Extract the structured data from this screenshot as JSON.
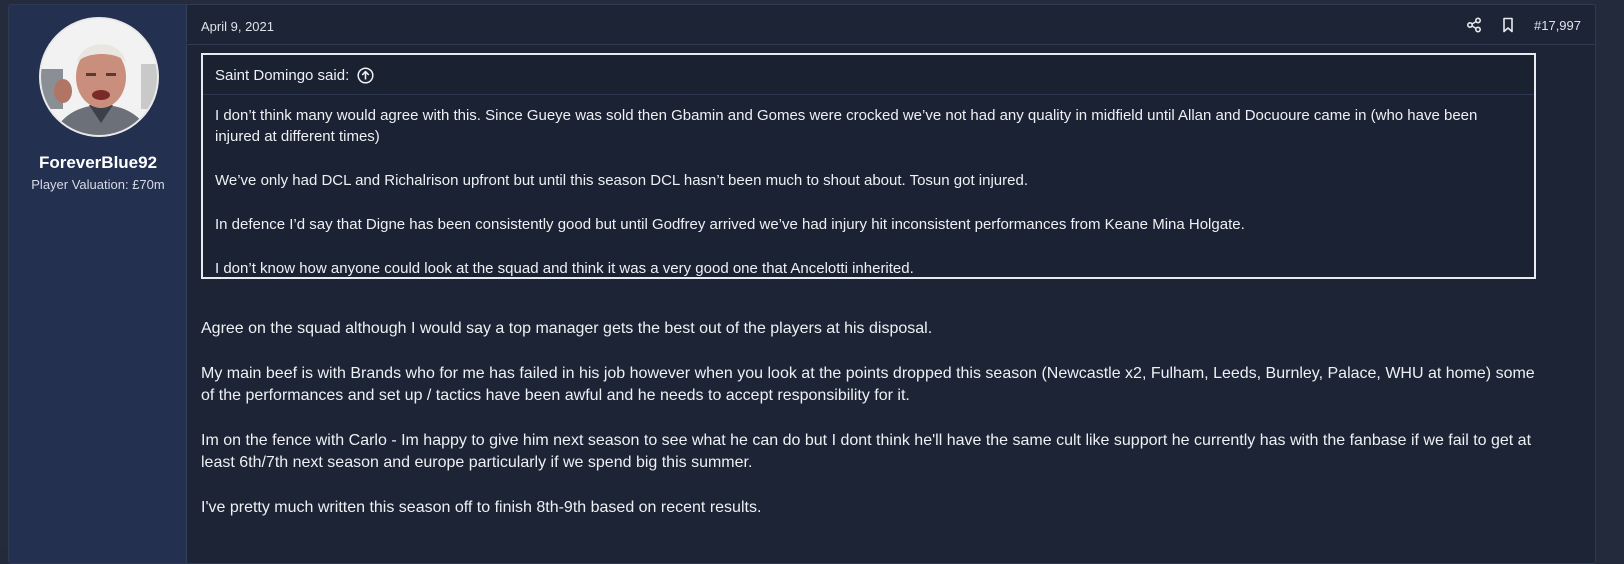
{
  "post": {
    "date": "April 9, 2021",
    "number": "#17,997",
    "author": {
      "username": "ForeverBlue92",
      "title": "Player Valuation: £70m"
    },
    "icons": {
      "share": "share-icon",
      "bookmark": "bookmark-icon",
      "quote_jump": "arrow-up-circle-icon"
    },
    "quote": {
      "header": "Saint Domingo said:",
      "paragraphs": [
        "I don’t think many would agree with this. Since Gueye was sold then Gbamin and Gomes were crocked we’ve not had any quality in midfield until Allan and Docuoure came in (who have been injured at different times)",
        "We’ve only had DCL and Richalrison upfront but until this season DCL hasn’t been much to shout about. Tosun got injured.",
        "In defence I’d say that Digne has been consistently good but until Godfrey arrived we’ve had injury hit inconsistent performances from Keane Mina Holgate.",
        "I don’t know how anyone could look at the squad and think it was a very good one that Ancelotti inherited."
      ]
    },
    "message": [
      "Agree on the squad although I would say a top manager gets the best out of the players at his disposal.",
      "My main beef is with Brands who for me has failed in his job however when you look at the points dropped this season (Newcastle x2, Fulham, Leeds, Burnley, Palace, WHU at home) some of the performances and set up / tactics have been awful and he needs to accept responsibility for it.",
      "Im on the fence with Carlo - Im happy to give him next season to see what he can do but I dont think he'll have the same cult like support he currently has with the fanbase if we fail to get at least 6th/7th next season and europe particularly if we spend big this summer.",
      "I've pretty much written this season off to finish 8th-9th based on recent results."
    ]
  }
}
